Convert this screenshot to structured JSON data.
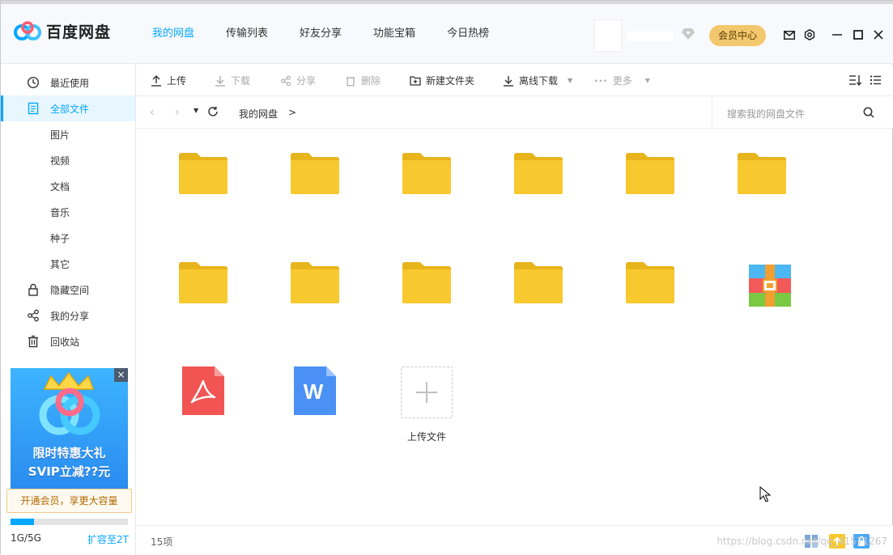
{
  "app": {
    "logo_text": "百度网盘"
  },
  "nav": [
    "我的网盘",
    "传输列表",
    "好友分享",
    "功能宝箱",
    "今日热榜"
  ],
  "header": {
    "vip_center": "会员中心"
  },
  "sidebar": {
    "items": [
      {
        "label": "最近使用",
        "icon": "clock-icon"
      },
      {
        "label": "全部文件",
        "icon": "document-icon"
      },
      {
        "label": "图片"
      },
      {
        "label": "视频"
      },
      {
        "label": "文档"
      },
      {
        "label": "音乐"
      },
      {
        "label": "种子"
      },
      {
        "label": "其它"
      },
      {
        "label": "隐藏空间",
        "icon": "lock-icon"
      },
      {
        "label": "我的分享",
        "icon": "share-icon"
      },
      {
        "label": "回收站",
        "icon": "trash-icon"
      }
    ],
    "promo": {
      "line1": "限时特惠大礼",
      "line2": "SVIP立减??元",
      "close": "×"
    },
    "vip_banner": "开通会员，享更大容量",
    "quota": {
      "text": "1G/5G",
      "used_fraction": 0.2,
      "expand": "扩容至2T"
    }
  },
  "toolbar": {
    "upload": "上传",
    "download": "下载",
    "share": "分享",
    "delete": "删除",
    "new_folder": "新建文件夹",
    "offline_download": "离线下载",
    "more": "更多"
  },
  "path": {
    "current": "我的网盘",
    "separator": ">"
  },
  "search": {
    "placeholder": "搜索我的网盘文件"
  },
  "files": {
    "upload_label": "上传文件"
  },
  "status": {
    "count": "15项",
    "watermark": "https://blog.csdn.net/qq_41571267"
  },
  "colors": {
    "accent": "#06a7ff",
    "folder": "#f7c92e",
    "folder_tab": "#e8b41b",
    "pdf": "#f25454",
    "word": "#4a90f5"
  }
}
